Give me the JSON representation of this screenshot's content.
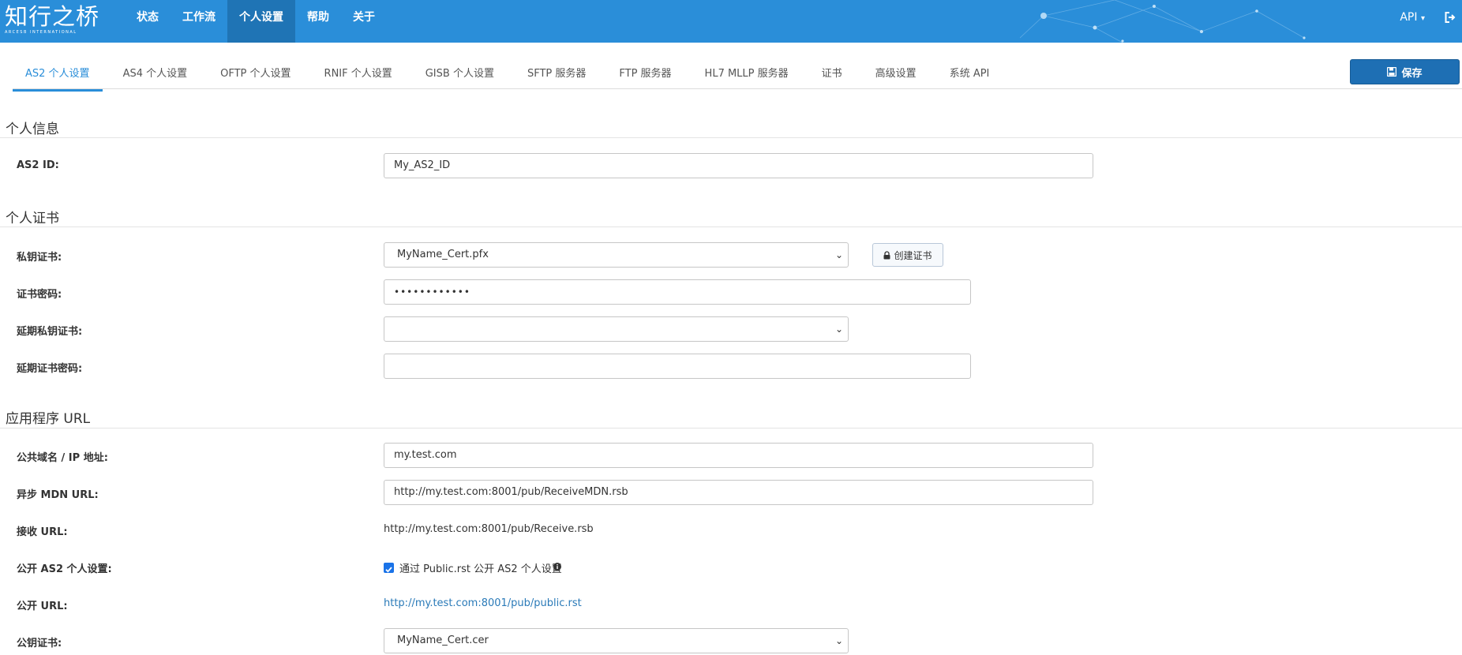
{
  "app": {
    "logo_main": "知行之桥",
    "logo_sub": "ARCESB INTERNATIONAL"
  },
  "nav": {
    "items": [
      "状态",
      "工作流",
      "个人设置",
      "帮助",
      "关于"
    ],
    "active": 2,
    "api_label": "API"
  },
  "tabs": {
    "items": [
      "AS2 个人设置",
      "AS4 个人设置",
      "OFTP 个人设置",
      "RNIF 个人设置",
      "GISB 个人设置",
      "SFTP 服务器",
      "FTP 服务器",
      "HL7 MLLP 服务器",
      "证书",
      "高级设置",
      "系统 API"
    ],
    "active": 0
  },
  "toolbar": {
    "save_label": "保存"
  },
  "sections": {
    "personal_info": "个人信息",
    "personal_cert": "个人证书",
    "app_url": "应用程序 URL"
  },
  "fields": {
    "as2_id": {
      "label": "AS2 ID:",
      "value": "My_AS2_ID"
    },
    "private_cert": {
      "label": "私钥证书:",
      "value": "MyName_Cert.pfx"
    },
    "create_cert_label": "创建证书",
    "cert_password": {
      "label": "证书密码:",
      "value": "••••••••••••"
    },
    "renew_private_cert": {
      "label": "延期私钥证书:",
      "value": ""
    },
    "renew_cert_password": {
      "label": "延期证书密码:",
      "value": ""
    },
    "public_domain": {
      "label": "公共域名 / IP 地址:",
      "value": "my.test.com"
    },
    "async_mdn_url": {
      "label": "异步 MDN URL:",
      "value": "http://my.test.com:8001/pub/ReceiveMDN.rsb"
    },
    "receive_url": {
      "label": "接收 URL:",
      "value": "http://my.test.com:8001/pub/Receive.rsb"
    },
    "publish_as2": {
      "label": "公开 AS2 个人设置:",
      "checkbox_text": "通过 Public.rst 公开 AS2 个人设置",
      "checked": true
    },
    "public_url": {
      "label": "公开 URL:",
      "value": "http://my.test.com:8001/pub/public.rst"
    },
    "public_cert": {
      "label": "公钥证书:",
      "value": "MyName_Cert.cer"
    }
  },
  "colors": {
    "header": "#2a8ed9",
    "nav_active": "#1f74b5",
    "save_button": "#1e6fb4",
    "link": "#2a7ab8"
  },
  "icons": {
    "save": "floppy-disk-icon",
    "lock": "lock-icon",
    "info": "info-circle-icon",
    "logout": "logout-icon",
    "caret": "caret-down-icon",
    "chevron": "chevron-down-icon"
  }
}
